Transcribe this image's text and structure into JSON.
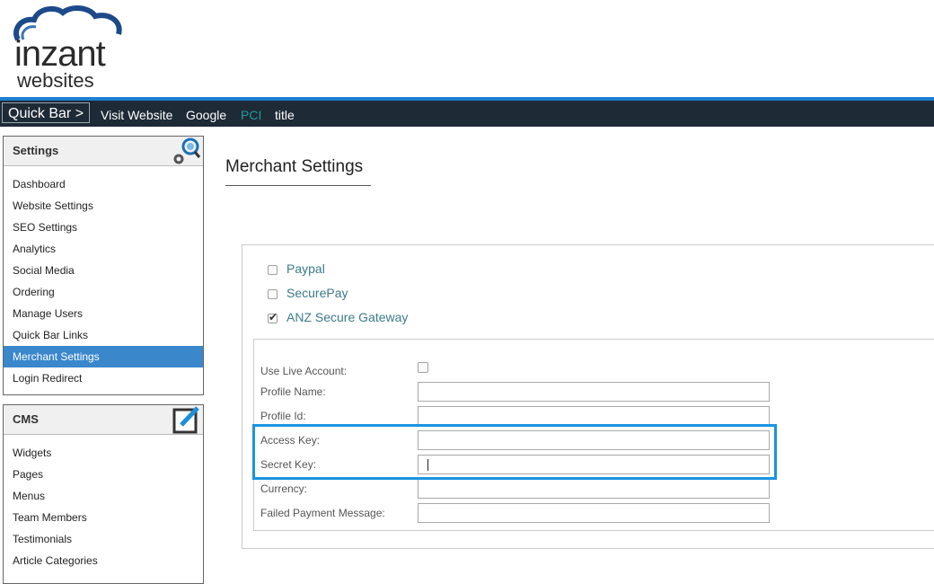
{
  "logo": {
    "line1": "inzant",
    "line2": "websites"
  },
  "quickbar": {
    "button_label": "Quick Bar >",
    "links": [
      "Visit Website",
      "Google",
      "PCI",
      "title"
    ]
  },
  "settings_panel": {
    "title": "Settings",
    "icon": "gears-search-icon",
    "items": [
      "Dashboard",
      "Website Settings",
      "SEO Settings",
      "Analytics",
      "Social Media",
      "Ordering",
      "Manage Users",
      "Quick Bar Links",
      "Merchant Settings",
      "Login Redirect"
    ],
    "active": "Merchant Settings"
  },
  "cms_panel": {
    "title": "CMS",
    "icon": "edit-icon",
    "items": [
      "Widgets",
      "Pages",
      "Menus",
      "Team Members",
      "Testimonials",
      "Article Categories"
    ]
  },
  "main": {
    "title": "Merchant Settings",
    "gateways": [
      {
        "label": "Paypal",
        "checked": false
      },
      {
        "label": "SecurePay",
        "checked": false
      },
      {
        "label": "ANZ Secure Gateway",
        "checked": true
      }
    ],
    "form": {
      "use_live_label": "Use Live Account:",
      "use_live_checked": false,
      "profile_name_label": "Profile Name:",
      "profile_name_value": "",
      "profile_id_label": "Profile Id:",
      "profile_id_value": "",
      "access_key_label": "Access Key:",
      "access_key_value": "",
      "secret_key_label": "Secret Key:",
      "secret_key_value": "",
      "currency_label": "Currency:",
      "currency_value": "",
      "failed_msg_label": "Failed Payment Message:",
      "failed_msg_value": ""
    }
  },
  "colors": {
    "accent": "#3a87cc",
    "quickbar_bg": "#1e2a36",
    "highlight": "#1a94e0",
    "option_text": "#3c7a8a"
  }
}
